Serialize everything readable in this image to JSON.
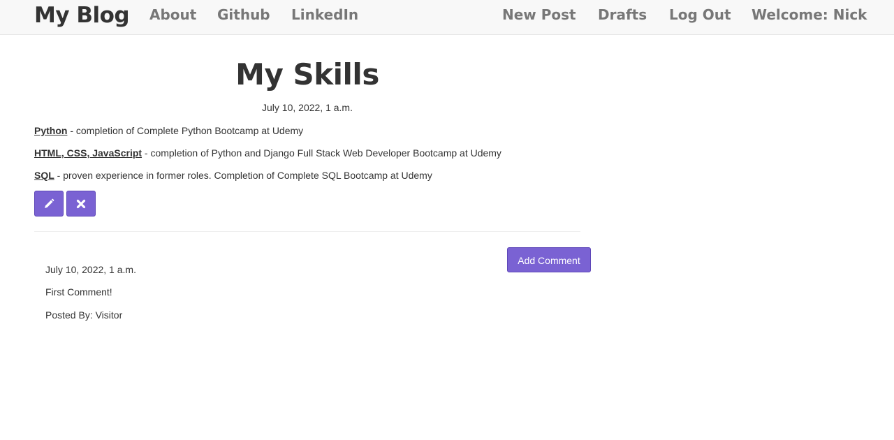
{
  "nav": {
    "brand": "My Blog",
    "left_links": [
      "About",
      "Github",
      "LinkedIn"
    ],
    "right_links": [
      "New Post",
      "Drafts",
      "Log Out"
    ],
    "welcome": "Welcome: Nick"
  },
  "post": {
    "title": "My Skills",
    "date": "July 10, 2022, 1 a.m.",
    "skills": [
      {
        "name": "Python",
        "detail": " - completion of Complete Python Bootcamp at Udemy"
      },
      {
        "name": "HTML, CSS, JavaScript",
        "detail": " - completion of Python and Django Full Stack Web Developer Bootcamp at Udemy"
      },
      {
        "name": "SQL",
        "detail": " - proven experience in former roles. Completion of Complete SQL Bootcamp at Udemy"
      }
    ],
    "edit_icon": "pencil-icon",
    "delete_icon": "close-icon"
  },
  "comments": {
    "add_label": "Add Comment",
    "items": [
      {
        "date": "July 10, 2022, 1 a.m.",
        "text": "First Comment!",
        "author": "Posted By: Visitor"
      }
    ]
  },
  "colors": {
    "accent": "#7a62d3",
    "nav_bg": "#f8f8f8",
    "nav_link": "#777777",
    "text": "#333333"
  }
}
